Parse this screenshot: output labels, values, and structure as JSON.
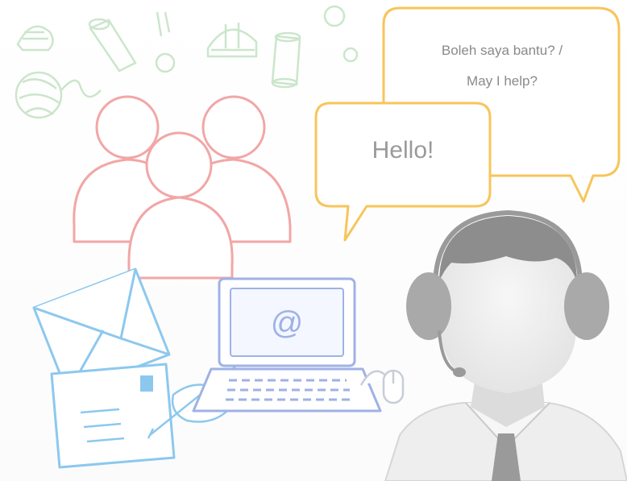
{
  "bubbles": {
    "back_text_line1": "Boleh saya bantu? /",
    "back_text_line2": "May I help?",
    "front_text": "Hello!"
  },
  "screen": {
    "at_symbol": "@"
  },
  "icons": [
    "thread-spool-icon",
    "yarn-ball-icon",
    "pincushion-icon",
    "sewing-button-icon",
    "people-group-icon",
    "envelope-icon",
    "postcard-icon",
    "pen-icon",
    "laptop-icon",
    "mouse-icon",
    "support-agent-icon",
    "headset-icon"
  ],
  "colors": {
    "people_outline": "#f2a6a6",
    "bubble_outline": "#f7c55a",
    "mail_outline": "#8cc8ee",
    "laptop_outline": "#9fb2e6",
    "agent_gray": "#a9a9a9",
    "craft_green": "#b9dcb9"
  }
}
